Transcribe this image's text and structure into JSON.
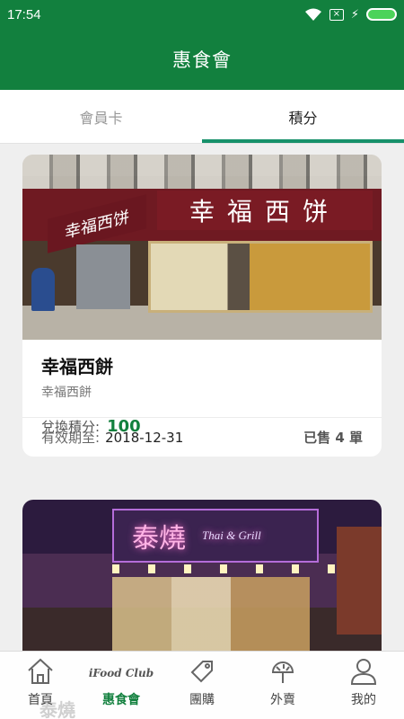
{
  "status_bar": {
    "time": "17:54"
  },
  "app_bar": {
    "title": "惠食會"
  },
  "tabs": [
    {
      "label": "會員卡",
      "active": false
    },
    {
      "label": "積分",
      "active": true
    }
  ],
  "cards": [
    {
      "photo_sign": "幸福西饼",
      "photo_left_sign": "幸福西饼",
      "name": "幸福西餅",
      "subtitle": "幸福西餅",
      "points_label": "兌換積分:",
      "points_value": "100",
      "expiry_label": "有效期至:",
      "expiry_date": "2018-12-31",
      "sold": "已售 4 單"
    },
    {
      "photo_sign": "泰燒",
      "photo_sign_sub": "Thai & Grill",
      "name_ghost": "泰燒"
    }
  ],
  "bottom_nav": [
    {
      "label": "首頁",
      "icon": "home-icon",
      "active": false
    },
    {
      "label": "惠食會",
      "icon": "ifood-club-logo",
      "logo_text": "iFood Club",
      "active": true
    },
    {
      "label": "團購",
      "icon": "tag-icon",
      "active": false
    },
    {
      "label": "外賣",
      "icon": "delivery-icon",
      "active": false
    },
    {
      "label": "我的",
      "icon": "user-icon",
      "active": false
    }
  ],
  "colors": {
    "brand_green": "#12803e",
    "tab_indicator": "#17916a",
    "battery_green": "#4cd35a"
  }
}
